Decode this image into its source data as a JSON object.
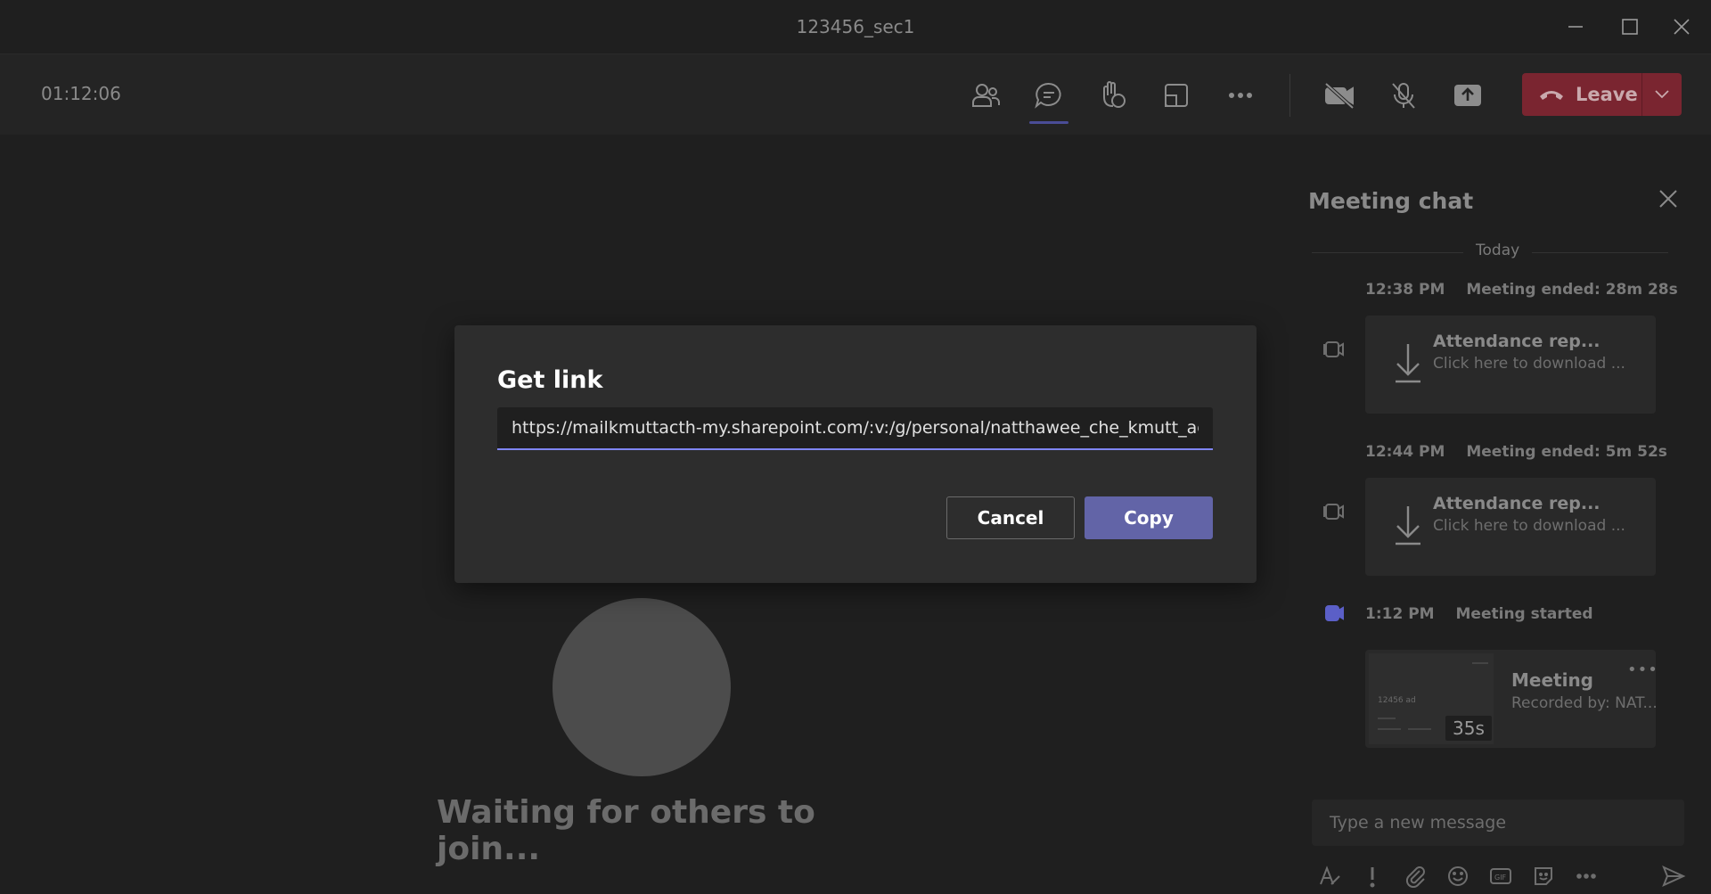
{
  "window": {
    "title": "123456_sec1"
  },
  "toolbar": {
    "timer": "01:12:06",
    "leave_label": "Leave",
    "icons": [
      "people-icon",
      "chat-icon",
      "reactions-icon",
      "rooms-icon",
      "more-icon",
      "camera-off-icon",
      "mic-off-icon",
      "share-icon"
    ]
  },
  "stage": {
    "waiting_text": "Waiting for others to join..."
  },
  "chat": {
    "title": "Meeting chat",
    "day_divider": "Today",
    "events": [
      {
        "time": "12:38 PM",
        "text": "Meeting ended: 28m 28s",
        "card_title": "Attendance rep...",
        "card_sub": "Click here to download ..."
      },
      {
        "time": "12:44 PM",
        "text": "Meeting ended: 5m 52s",
        "card_title": "Attendance rep...",
        "card_sub": "Click here to download ..."
      },
      {
        "time": "1:12 PM",
        "text": "Meeting started"
      }
    ],
    "recording": {
      "title": "Meeting",
      "subtitle": "Recorded by: NAT...",
      "duration": "35s",
      "thumb_text": "12456 ad"
    },
    "compose_placeholder": "Type a new message"
  },
  "dialog": {
    "title": "Get link",
    "link_value": "https://mailkmuttacth-my.sharepoint.com/:v:/g/personal/natthawee_che_kmutt_ac_",
    "cancel_label": "Cancel",
    "copy_label": "Copy"
  },
  "colors": {
    "accent": "#6264a7",
    "leave": "#7a2530",
    "focus_underline": "#7f85f5"
  }
}
